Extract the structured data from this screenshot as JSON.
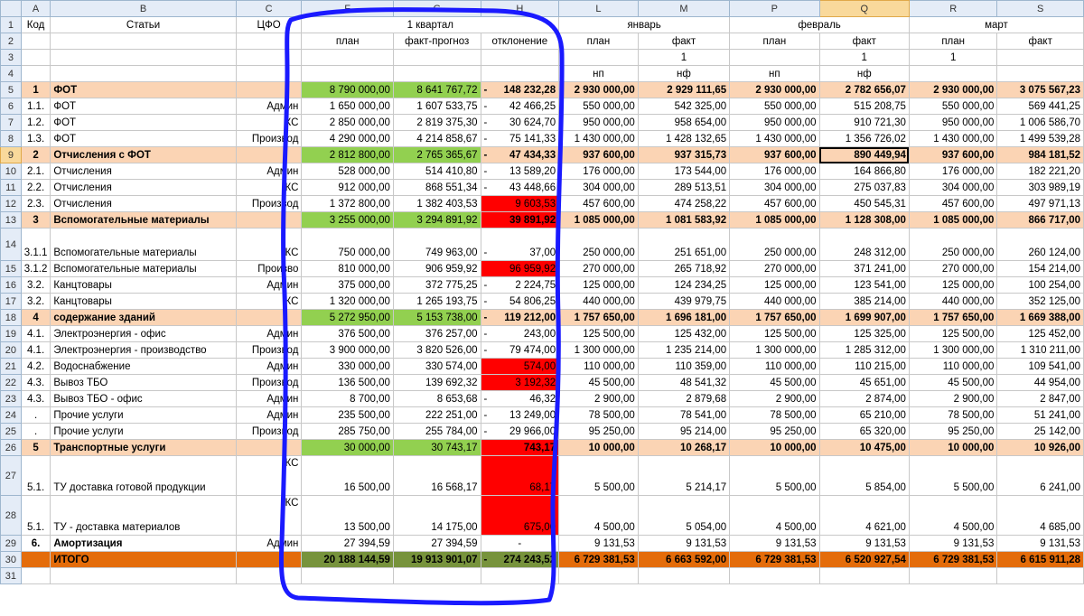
{
  "columns": [
    "A",
    "B",
    "C",
    "F",
    "G",
    "H",
    "L",
    "M",
    "P",
    "Q",
    "R",
    "S"
  ],
  "selected_column": "Q",
  "selected_row": "9",
  "header_rows": [
    {
      "row": "1",
      "cells": [
        "Код",
        "Статьи",
        "ЦФО",
        "1 квартал",
        "",
        "",
        "январь",
        "",
        "февраль",
        "",
        "март",
        ""
      ]
    },
    {
      "row": "2",
      "cells": [
        "",
        "",
        "",
        "план",
        "факт-прогноз",
        "отклонение",
        "план",
        "факт",
        "план",
        "факт",
        "план",
        "факт"
      ]
    },
    {
      "row": "3",
      "cells": [
        "",
        "",
        "",
        "",
        "",
        "",
        "",
        "1",
        "",
        "1",
        "1",
        ""
      ]
    },
    {
      "row": "4",
      "cells": [
        "",
        "",
        "",
        "",
        "",
        "",
        "нп",
        "нф",
        "нп",
        "нф",
        "",
        ""
      ]
    }
  ],
  "rows": [
    {
      "row": "5",
      "type": "sec",
      "cells": [
        "1",
        "ФОТ",
        "",
        "8 790 000,00",
        "8 641 767,72",
        "- 148 232,28",
        "2 930 000,00",
        "2 929 111,65",
        "2 930 000,00",
        "2 782 656,07",
        "2 930 000,00",
        "3 075 567,23"
      ],
      "g": [
        3,
        4
      ],
      "r": []
    },
    {
      "row": "6",
      "type": "n",
      "cells": [
        "1.1.",
        "ФОТ",
        "Админ",
        "1 650 000,00",
        "1 607 533,75",
        "- 42 466,25",
        "550 000,00",
        "542 325,00",
        "550 000,00",
        "515 208,75",
        "550 000,00",
        "569 441,25"
      ],
      "g": [],
      "r": []
    },
    {
      "row": "7",
      "type": "n",
      "cells": [
        "1.2.",
        "ФОТ",
        "КС",
        "2 850 000,00",
        "2 819 375,30",
        "- 30 624,70",
        "950 000,00",
        "958 654,00",
        "950 000,00",
        "910 721,30",
        "950 000,00",
        "1 006 586,70"
      ],
      "g": [],
      "r": []
    },
    {
      "row": "8",
      "type": "n",
      "cells": [
        "1.3.",
        "ФОТ",
        "Производ",
        "4 290 000,00",
        "4 214 858,67",
        "- 75 141,33",
        "1 430 000,00",
        "1 428 132,65",
        "1 430 000,00",
        "1 356 726,02",
        "1 430 000,00",
        "1 499 539,28"
      ],
      "g": [],
      "r": []
    },
    {
      "row": "9",
      "type": "sec",
      "cells": [
        "2",
        "Отчисления с ФОТ",
        "",
        "2 812 800,00",
        "2 765 365,67",
        "- 47 434,33",
        "937 600,00",
        "937 315,73",
        "937 600,00",
        "890 449,94",
        "937 600,00",
        "984 181,52"
      ],
      "g": [
        3,
        4
      ],
      "r": []
    },
    {
      "row": "10",
      "type": "n",
      "cells": [
        "2.1.",
        "Отчисления",
        "Админ",
        "528 000,00",
        "514 410,80",
        "- 13 589,20",
        "176 000,00",
        "173 544,00",
        "176 000,00",
        "164 866,80",
        "176 000,00",
        "182 221,20"
      ],
      "g": [],
      "r": []
    },
    {
      "row": "11",
      "type": "n",
      "cells": [
        "2.2.",
        "Отчисления",
        "КС",
        "912 000,00",
        "868 551,34",
        "- 43 448,66",
        "304 000,00",
        "289 513,51",
        "304 000,00",
        "275 037,83",
        "304 000,00",
        "303 989,19"
      ],
      "g": [],
      "r": []
    },
    {
      "row": "12",
      "type": "n",
      "cells": [
        "2.3.",
        "Отчисления",
        "Производ",
        "1 372 800,00",
        "1 382 403,53",
        "9 603,53",
        "457 600,00",
        "474 258,22",
        "457 600,00",
        "450 545,31",
        "457 600,00",
        "497 971,13"
      ],
      "g": [],
      "r": [
        5
      ]
    },
    {
      "row": "13",
      "type": "sec",
      "cells": [
        "3",
        "Вспомогательные материалы",
        "",
        "3 255 000,00",
        "3 294 891,92",
        "39 891,92",
        "1 085 000,00",
        "1 081 583,92",
        "1 085 000,00",
        "1 128 308,00",
        "1 085 000,00",
        "866 717,00"
      ],
      "g": [
        3,
        4
      ],
      "r": [
        5
      ]
    },
    {
      "row": "14",
      "type": "tall",
      "cells": [
        "3.1.1",
        "Вспомогательные материалы",
        "КС",
        "750 000,00",
        "749 963,00",
        "- 37,00",
        "250 000,00",
        "251 651,00",
        "250 000,00",
        "248 312,00",
        "250 000,00",
        "260 124,00"
      ],
      "g": [],
      "r": []
    },
    {
      "row": "15",
      "type": "n",
      "cells": [
        "3.1.2",
        "Вспомогательные материалы",
        "Произво",
        "810 000,00",
        "906 959,92",
        "96 959,92",
        "270 000,00",
        "265 718,92",
        "270 000,00",
        "371 241,00",
        "270 000,00",
        "154 214,00"
      ],
      "g": [],
      "r": [
        5
      ]
    },
    {
      "row": "16",
      "type": "n",
      "cells": [
        "3.2.",
        "Канцтовары",
        "Админ",
        "375 000,00",
        "372 775,25",
        "- 2 224,75",
        "125 000,00",
        "124 234,25",
        "125 000,00",
        "123 541,00",
        "125 000,00",
        "100 254,00"
      ],
      "g": [],
      "r": []
    },
    {
      "row": "17",
      "type": "n",
      "cells": [
        "3.2.",
        "Канцтовары",
        "КС",
        "1 320 000,00",
        "1 265 193,75",
        "- 54 806,25",
        "440 000,00",
        "439 979,75",
        "440 000,00",
        "385 214,00",
        "440 000,00",
        "352 125,00"
      ],
      "g": [],
      "r": []
    },
    {
      "row": "18",
      "type": "sec",
      "cells": [
        "4",
        "содержание зданий",
        "",
        "5 272 950,00",
        "5 153 738,00",
        "- 119 212,00",
        "1 757 650,00",
        "1 696 181,00",
        "1 757 650,00",
        "1 699 907,00",
        "1 757 650,00",
        "1 669 388,00"
      ],
      "g": [
        3,
        4
      ],
      "r": []
    },
    {
      "row": "19",
      "type": "n",
      "cells": [
        "4.1.",
        "Электроэнергия - офис",
        "Админ",
        "376 500,00",
        "376 257,00",
        "- 243,00",
        "125 500,00",
        "125 432,00",
        "125 500,00",
        "125 325,00",
        "125 500,00",
        "125 452,00"
      ],
      "g": [],
      "r": []
    },
    {
      "row": "20",
      "type": "n",
      "cells": [
        "4.1.",
        "Электроэнергия - производство",
        "Производ",
        "3 900 000,00",
        "3 820 526,00",
        "- 79 474,00",
        "1 300 000,00",
        "1 235 214,00",
        "1 300 000,00",
        "1 285 312,00",
        "1 300 000,00",
        "1 310 211,00"
      ],
      "g": [],
      "r": []
    },
    {
      "row": "21",
      "type": "n",
      "cells": [
        "4.2.",
        "Водоснабжение",
        "Админ",
        "330 000,00",
        "330 574,00",
        "574,00",
        "110 000,00",
        "110 359,00",
        "110 000,00",
        "110 215,00",
        "110 000,00",
        "109 541,00"
      ],
      "g": [],
      "r": [
        5
      ]
    },
    {
      "row": "22",
      "type": "n",
      "cells": [
        "4.3.",
        "Вывоз ТБО",
        "Производ",
        "136 500,00",
        "139 692,32",
        "3 192,32",
        "45 500,00",
        "48 541,32",
        "45 500,00",
        "45 651,00",
        "45 500,00",
        "44 954,00"
      ],
      "g": [],
      "r": [
        5
      ]
    },
    {
      "row": "23",
      "type": "n",
      "cells": [
        "4.3.",
        "Вывоз ТБО - офис",
        "Админ",
        "8 700,00",
        "8 653,68",
        "- 46,32",
        "2 900,00",
        "2 879,68",
        "2 900,00",
        "2 874,00",
        "2 900,00",
        "2 847,00"
      ],
      "g": [],
      "r": []
    },
    {
      "row": "24",
      "type": "n",
      "cells": [
        ".",
        "Прочие услуги",
        "Админ",
        "235 500,00",
        "222 251,00",
        "- 13 249,00",
        "78 500,00",
        "78 541,00",
        "78 500,00",
        "65 210,00",
        "78 500,00",
        "51 241,00"
      ],
      "g": [],
      "r": []
    },
    {
      "row": "25",
      "type": "n",
      "cells": [
        ".",
        "Прочие услуги",
        "Производ",
        "285 750,00",
        "255 784,00",
        "- 29 966,00",
        "95 250,00",
        "95 214,00",
        "95 250,00",
        "65 320,00",
        "95 250,00",
        "25 142,00"
      ],
      "g": [],
      "r": []
    },
    {
      "row": "26",
      "type": "sec",
      "cells": [
        "5",
        "Транспортные услуги",
        "",
        "30 000,00",
        "30 743,17",
        "743,17",
        "10 000,00",
        "10 268,17",
        "10 000,00",
        "10 475,00",
        "10 000,00",
        "10 926,00"
      ],
      "g": [
        3,
        4
      ],
      "r": [
        5
      ]
    },
    {
      "row": "27",
      "type": "big",
      "cells": [
        "5.1.",
        "ТУ доставка готовой продукции",
        "КС",
        "16 500,00",
        "16 568,17",
        "68,17",
        "5 500,00",
        "5 214,17",
        "5 500,00",
        "5 854,00",
        "5 500,00",
        "6 241,00"
      ],
      "g": [],
      "r": [
        5
      ]
    },
    {
      "row": "28",
      "type": "big",
      "cells": [
        "5.1.",
        "ТУ - доставка материалов",
        "КС",
        "13 500,00",
        "14 175,00",
        "675,00",
        "4 500,00",
        "5 054,00",
        "4 500,00",
        "4 621,00",
        "4 500,00",
        "4 685,00"
      ],
      "g": [],
      "r": [
        5
      ]
    },
    {
      "row": "29",
      "type": "bold",
      "cells": [
        "6.",
        "Амортизация",
        "Админ",
        "27 394,59",
        "27 394,59",
        "-",
        "9 131,53",
        "9 131,53",
        "9 131,53",
        "9 131,53",
        "9 131,53",
        "9 131,53"
      ],
      "g": [],
      "r": []
    },
    {
      "row": "30",
      "type": "tot",
      "cells": [
        "",
        "ИТОГО",
        "",
        "20 188 144,59",
        "19 913 901,07",
        "- 274 243,52",
        "6 729 381,53",
        "6 663 592,00",
        "6 729 381,53",
        "6 520 927,54",
        "6 729 381,53",
        "6 615 911,28"
      ],
      "g": [
        3,
        4,
        5
      ],
      "r": []
    },
    {
      "row": "31",
      "type": "stub",
      "cells": [
        "",
        "",
        "",
        "",
        "",
        "",
        "",
        "",
        "",
        "",
        "",
        ""
      ],
      "g": [],
      "r": []
    }
  ],
  "annotation_color": "#1a1aff"
}
